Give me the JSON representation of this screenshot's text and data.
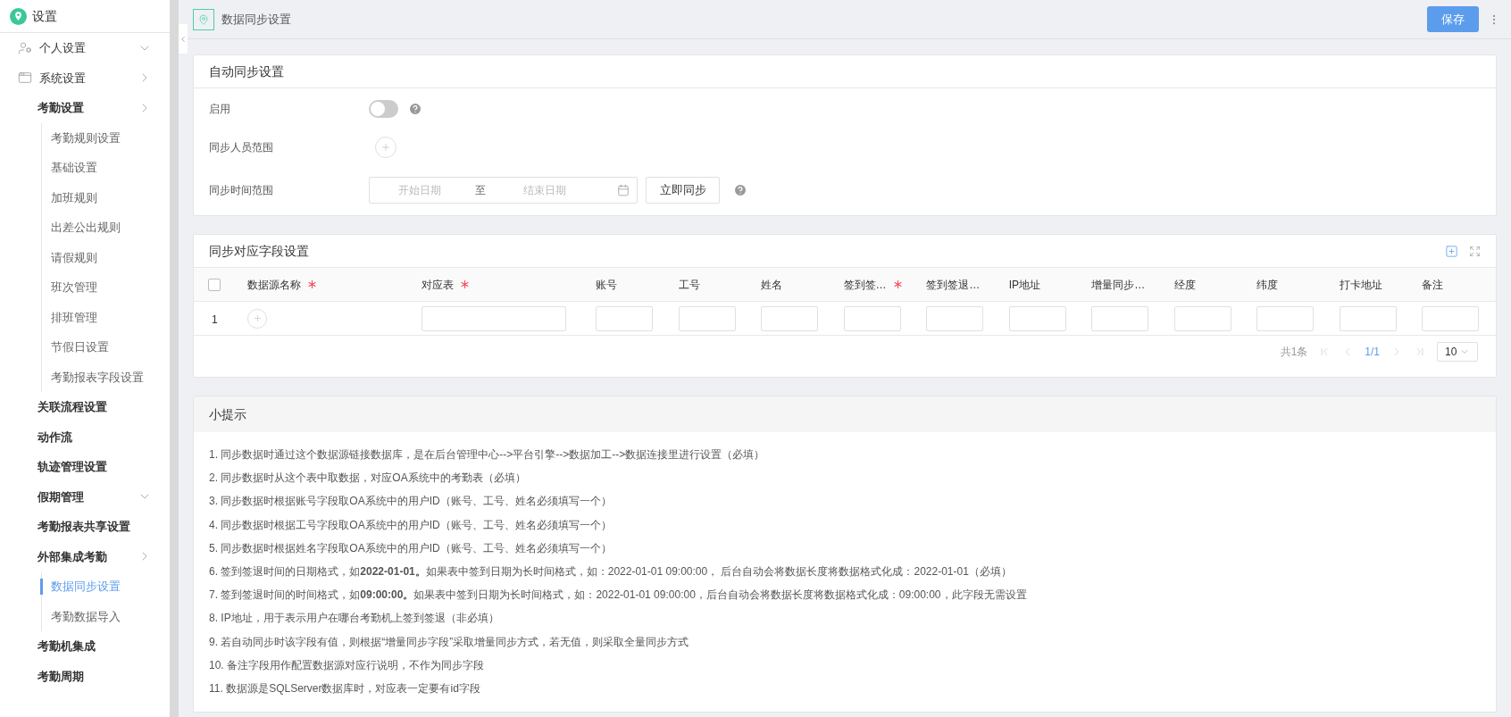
{
  "sidebar": {
    "title": "设置",
    "items": [
      {
        "label": "个人设置",
        "kind": "user",
        "expanded": true
      },
      {
        "label": "系统设置",
        "kind": "window",
        "expanded": false,
        "children": [
          {
            "label": "考勤设置",
            "expanded": false,
            "children": [
              {
                "label": "考勤规则设置",
                "selected": false
              },
              {
                "label": "基础设置",
                "selected": false
              },
              {
                "label": "加班规则",
                "selected": false
              },
              {
                "label": "出差公出规则",
                "selected": false
              },
              {
                "label": "请假规则",
                "selected": false
              },
              {
                "label": "班次管理",
                "selected": false
              },
              {
                "label": "排班管理",
                "selected": false
              },
              {
                "label": "节假日设置",
                "selected": false
              },
              {
                "label": "考勤报表字段设置",
                "selected": false
              }
            ]
          },
          {
            "label": "关联流程设置"
          },
          {
            "label": "动作流"
          },
          {
            "label": "轨迹管理设置"
          },
          {
            "label": "假期管理",
            "expanded": true
          },
          {
            "label": "考勤报表共享设置"
          },
          {
            "label": "外部集成考勤",
            "expanded": false,
            "children": [
              {
                "label": "数据同步设置",
                "selected": true
              },
              {
                "label": "考勤数据导入",
                "selected": false
              }
            ]
          },
          {
            "label": "考勤机集成"
          },
          {
            "label": "考勤周期"
          }
        ]
      }
    ]
  },
  "header": {
    "title": "数据同步设置",
    "save_button": "保存"
  },
  "auto_sync": {
    "title": "自动同步设置",
    "enable": {
      "label": "启用",
      "on": false
    },
    "scope": {
      "label": "同步人员范围"
    },
    "time_range": {
      "label": "同步时间范围",
      "start_placeholder": "开始日期",
      "separator": "至",
      "end_placeholder": "结束日期",
      "button": "立即同步"
    }
  },
  "field_mapping": {
    "title": "同步对应字段设置",
    "select_all": {
      "checked": false
    },
    "columns": [
      {
        "label": "数据源名称",
        "required": true
      },
      {
        "label": "对应表",
        "required": true
      },
      {
        "label": "账号",
        "required": false
      },
      {
        "label": "工号",
        "required": false
      },
      {
        "label": "姓名",
        "required": false
      },
      {
        "label": "签到签…",
        "required": true
      },
      {
        "label": "签到签退…",
        "required": false
      },
      {
        "label": "IP地址",
        "required": false
      },
      {
        "label": "增量同步…",
        "required": false
      },
      {
        "label": "经度",
        "required": false
      },
      {
        "label": "纬度",
        "required": false
      },
      {
        "label": "打卡地址",
        "required": false
      },
      {
        "label": "备注",
        "required": false
      }
    ],
    "rows": [
      {
        "index": "1",
        "cells": [
          {
            "kind": "add"
          },
          {
            "kind": "input"
          },
          {
            "kind": "input"
          },
          {
            "kind": "input"
          },
          {
            "kind": "input"
          },
          {
            "kind": "input"
          },
          {
            "kind": "input"
          },
          {
            "kind": "input"
          },
          {
            "kind": "input"
          },
          {
            "kind": "input"
          },
          {
            "kind": "input"
          },
          {
            "kind": "input"
          },
          {
            "kind": "input"
          }
        ]
      }
    ],
    "pagination": {
      "total": "共1条",
      "page": "1/1",
      "page_size": "10"
    }
  },
  "tips": {
    "title": "小提示",
    "items": [
      "1. 同步数据时通过这个数据源链接数据库，是在后台管理中心-->平台引擎-->数据加工-->数据连接里进行设置（必填）",
      "2. 同步数据时从这个表中取数据，对应OA系统中的考勤表（必填）",
      "3. 同步数据时根据账号字段取OA系统中的用户ID（账号、工号、姓名必须填写一个）",
      "4. 同步数据时根据工号字段取OA系统中的用户ID（账号、工号、姓名必须填写一个）",
      "5. 同步数据时根据姓名字段取OA系统中的用户ID（账号、工号、姓名必须填写一个）",
      "6. 签到签退时间的日期格式，如**2022-01-01。**如果表中签到日期为长时间格式，如：2022-01-01 09:00:00， 后台自动会将数据长度将数据格式化成：2022-01-01（必填）",
      "7. 签到签退时间的时间格式，如**09:00:00。**如果表中签到日期为长时间格式，如：2022-01-01 09:00:00，后台自动会将数据长度将数据格式化成：09:00:00，此字段无需设置",
      "8. IP地址，用于表示用户在哪台考勤机上签到签退（非必填）",
      "9. 若自动同步时该字段有值，则根据“增量同步字段”采取增量同步方式，若无值，则采取全量同步方式",
      "10. 备注字段用作配置数据源对应行说明，不作为同步字段",
      "11. 数据源是SQLServer数据库时，对应表一定要有id字段"
    ]
  }
}
